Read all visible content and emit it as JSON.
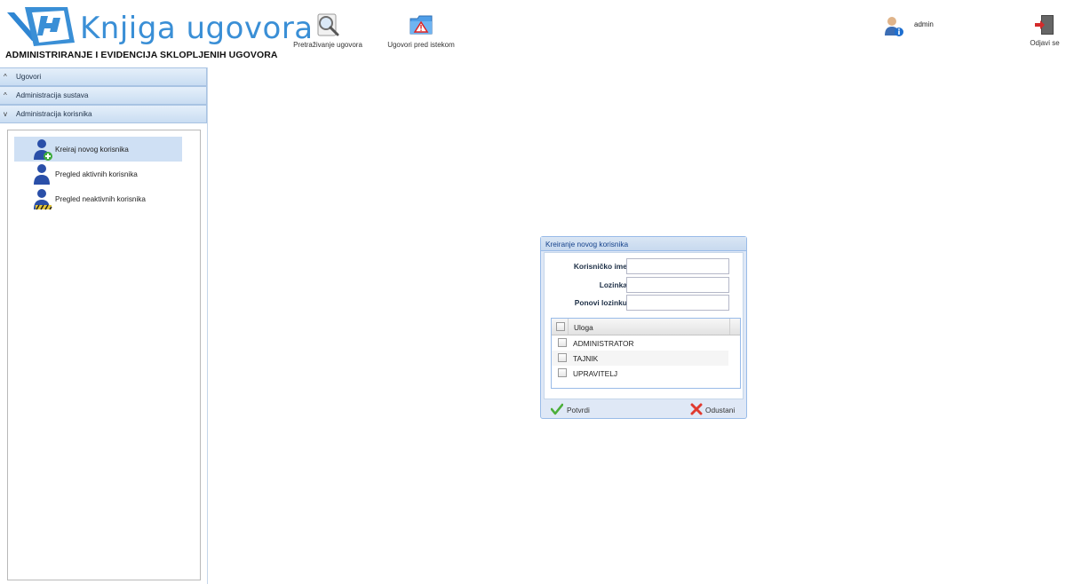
{
  "app": {
    "logo_title": "Knjiga ugovora",
    "logo_subtitle": "ADMINISTRIRANJE I EVIDENCIJA SKLOPLJENIH UGOVORA"
  },
  "toolbar": {
    "search_label": "Pretraživanje ugovora",
    "search_icon": "magnifier-icon",
    "expiring_label": "Ugovori pred istekom",
    "expiring_icon": "folder-warning-icon",
    "user_name": "admin",
    "user_icon": "user-info-icon",
    "logout_label": "Odjavi se",
    "logout_icon": "door-exit-icon"
  },
  "sidebar": {
    "sections": [
      {
        "label": "Ugovori",
        "chevron": "^"
      },
      {
        "label": "Administracija sustava",
        "chevron": "^"
      },
      {
        "label": "Administracija korisnika",
        "chevron": "v"
      }
    ],
    "items": [
      {
        "label": "Kreiraj novog korisnika",
        "icon": "user-add-icon",
        "active": true
      },
      {
        "label": "Pregled aktivnih korisnika",
        "icon": "user-icon",
        "active": false
      },
      {
        "label": "Pregled neaktivnih korisnika",
        "icon": "user-inactive-icon",
        "active": false
      }
    ]
  },
  "dialog": {
    "title": "Kreiranje novog korisnika",
    "fields": {
      "username_label": "Korisničko ime :",
      "username_value": "",
      "password_label": "Lozinka :",
      "password_value": "",
      "repeat_label": "Ponovi lozinku :",
      "repeat_value": ""
    },
    "grid": {
      "header": "Uloga",
      "rows": [
        "ADMINISTRATOR",
        "TAJNIK",
        "UPRAVITELJ"
      ]
    },
    "confirm_label": "Potvrdi",
    "cancel_label": "Odustani"
  },
  "colors": {
    "brand": "#3a8fd6",
    "accordion": "#c9ddf2",
    "dialog_border": "#99bbe8",
    "active_item": "#cfe0f4"
  }
}
